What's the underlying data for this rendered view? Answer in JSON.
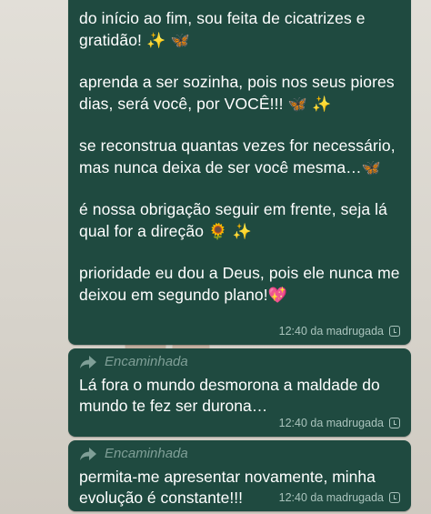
{
  "messages": [
    {
      "paragraphs": [
        {
          "text": " do início ao fim, sou feita de cicatrizes e gratidão! ",
          "emoji": "✨ 🦋"
        },
        {
          "text": "aprenda a ser sozinha, pois nos seus piores dias, será você, por VOCÊ!!! ",
          "emoji": "🦋 ✨"
        },
        {
          "text": " se reconstrua quantas vezes for necessário, mas nunca deixa de ser você mesma…",
          "emoji": "🦋"
        },
        {
          "text": "é nossa obrigação seguir em frente, seja lá qual for a direção ",
          "emoji": "🌻 ✨"
        },
        {
          "text": "prioridade eu dou a Deus, pois ele nunca me deixou em segundo plano!",
          "emoji": "💖"
        }
      ],
      "time": "12:40 da madrugada"
    },
    {
      "forwarded_label": "Encaminhada",
      "text": "Lá fora o mundo desmorona a maldade do mundo te fez ser durona…",
      "time": "12:40 da madrugada"
    },
    {
      "forwarded_label": "Encaminhada",
      "text": "permita-me apresentar novamente, minha evolução é constante!!!",
      "time": "12:40 da madrugada"
    }
  ],
  "icons": {
    "forward": "forward-arrow-icon",
    "status": "clock-icon"
  },
  "colors": {
    "bubble": "#1f4a40",
    "meta": "#a9c3bc",
    "forwarded": "#7f9f97"
  }
}
